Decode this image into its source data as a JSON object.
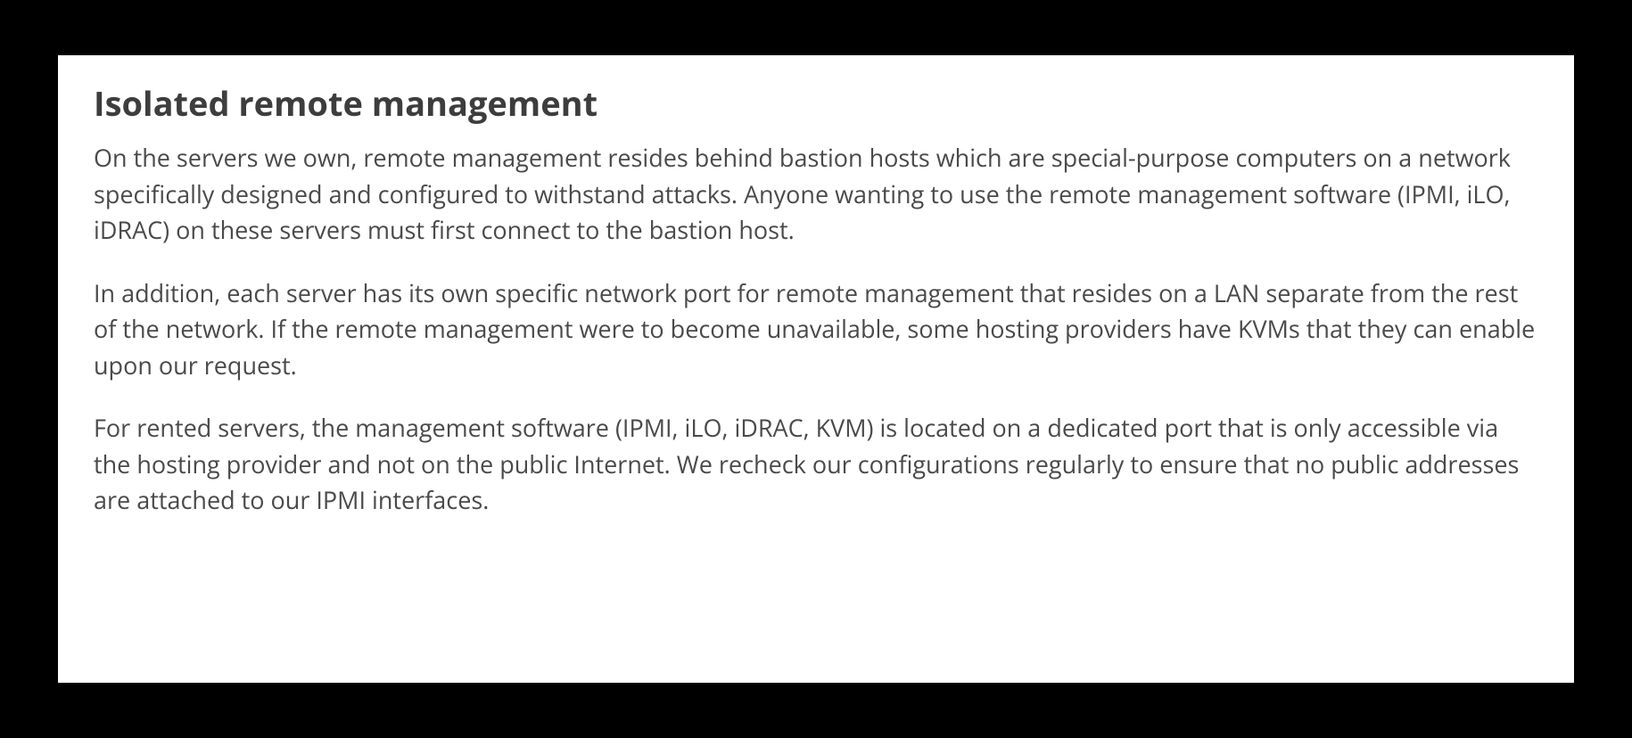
{
  "document": {
    "heading": "Isolated remote management",
    "paragraphs": [
      "On the servers we own, remote management resides behind bastion hosts which are special-purpose computers on a network specifically designed and configured to withstand attacks. Anyone wanting to use the remote management software (IPMI, iLO, iDRAC) on these servers must first connect to the bastion host.",
      "In addition, each server has its own specific network port for remote management that resides on a LAN separate from the rest of the network. If the remote management were to become unavailable, some hosting providers have KVMs that they can enable upon our request.",
      "For rented servers, the management software (IPMI, iLO, iDRAC, KVM) is located on a dedicated port that is only accessible via the hosting provider and not on the public Internet. We recheck our configurations regularly to ensure that no public addresses are attached to our IPMI interfaces."
    ]
  }
}
